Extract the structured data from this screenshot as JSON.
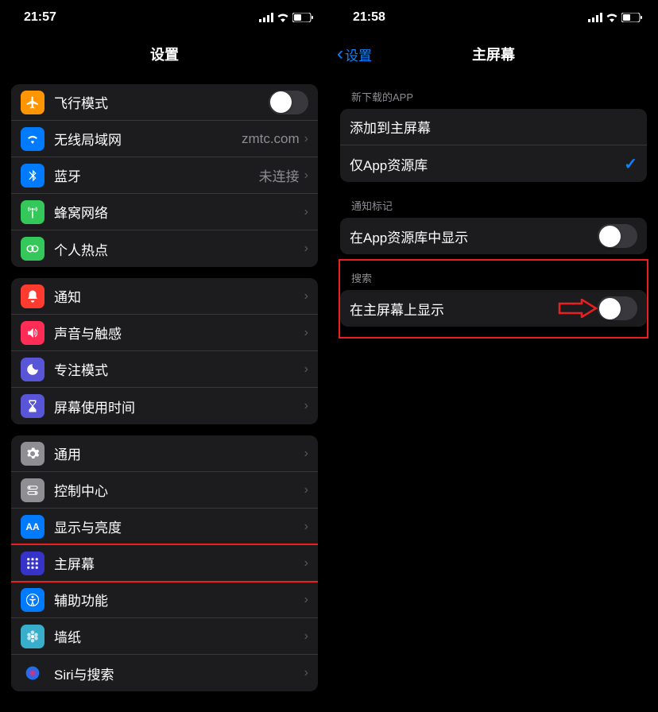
{
  "left": {
    "status_time": "21:57",
    "title": "设置",
    "groups": [
      {
        "rows": [
          {
            "icon": "airplane",
            "color": "#ff9500",
            "label": "飞行模式",
            "control": "toggle",
            "toggle_on": false
          },
          {
            "icon": "wifi",
            "color": "#007aff",
            "label": "无线局域网",
            "detail": "zmtc.com",
            "chevron": true
          },
          {
            "icon": "bluetooth",
            "color": "#007aff",
            "label": "蓝牙",
            "detail": "未连接",
            "chevron": true
          },
          {
            "icon": "antenna",
            "color": "#34c759",
            "label": "蜂窝网络",
            "chevron": true
          },
          {
            "icon": "hotspot",
            "color": "#34c759",
            "label": "个人热点",
            "chevron": true
          }
        ]
      },
      {
        "rows": [
          {
            "icon": "bell",
            "color": "#ff3b30",
            "label": "通知",
            "chevron": true
          },
          {
            "icon": "speaker",
            "color": "#ff3b30",
            "label": "声音与触感",
            "chevron": true
          },
          {
            "icon": "moon",
            "color": "#5856d6",
            "label": "专注模式",
            "chevron": true
          },
          {
            "icon": "hourglass",
            "color": "#5856d6",
            "label": "屏幕使用时间",
            "chevron": true
          }
        ]
      },
      {
        "rows": [
          {
            "icon": "gear",
            "color": "#8e8e93",
            "label": "通用",
            "chevron": true
          },
          {
            "icon": "switches",
            "color": "#8e8e93",
            "label": "控制中心",
            "chevron": true
          },
          {
            "icon": "AA",
            "color": "#007aff",
            "label": "显示与亮度",
            "chevron": true
          },
          {
            "icon": "grid",
            "color": "#4a4ae0",
            "label": "主屏幕",
            "chevron": true,
            "highlight": true
          },
          {
            "icon": "accessibility",
            "color": "#007aff",
            "label": "辅助功能",
            "chevron": true
          },
          {
            "icon": "flower",
            "color": "#38adcc",
            "label": "墙纸",
            "chevron": true
          },
          {
            "icon": "siri",
            "color": "#1c1c1e",
            "label": "Siri与搜索",
            "chevron": true
          }
        ]
      }
    ]
  },
  "right": {
    "status_time": "21:58",
    "back": "设置",
    "title": "主屏幕",
    "sections": [
      {
        "header": "新下载的APP",
        "rows": [
          {
            "label": "添加到主屏幕"
          },
          {
            "label": "仅App资源库",
            "checkmark": true
          }
        ]
      },
      {
        "header": "通知标记",
        "rows": [
          {
            "label": "在App资源库中显示",
            "control": "toggle",
            "toggle_on": false
          }
        ]
      },
      {
        "header": "搜索",
        "rows": [
          {
            "label": "在主屏幕上显示",
            "control": "toggle",
            "toggle_on": false,
            "arrow": true
          }
        ],
        "highlight": true
      }
    ]
  }
}
